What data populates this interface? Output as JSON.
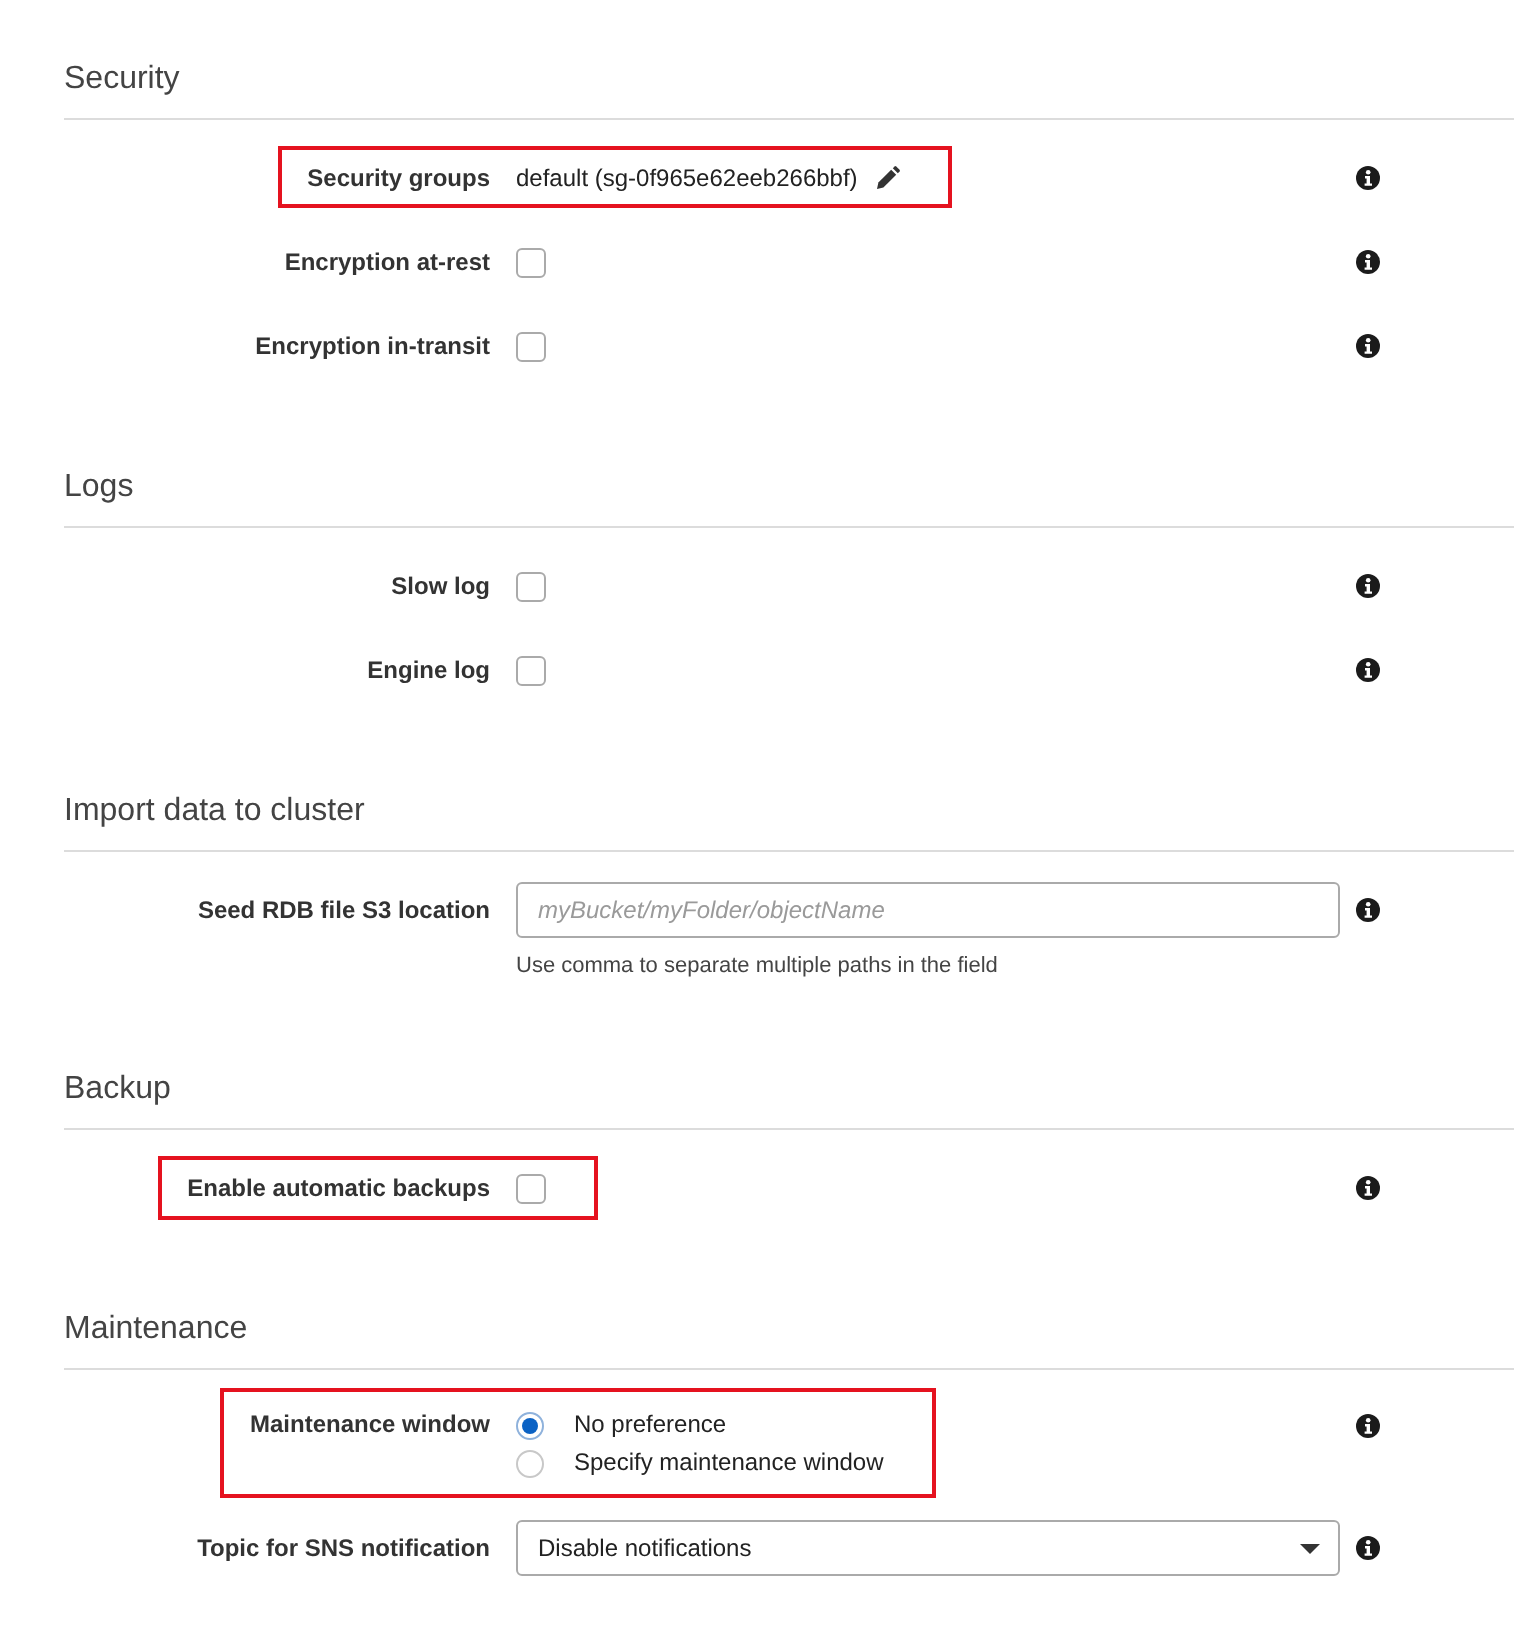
{
  "sections": [
    {
      "title": "Security",
      "rows": [
        {
          "kind": "value",
          "label": "Security groups",
          "value": "default (sg-0f965e62eeb266bbf)",
          "editable": true,
          "highlighted": true
        },
        {
          "kind": "checkbox",
          "label": "Encryption at-rest",
          "checked": false,
          "highlighted": false
        },
        {
          "kind": "checkbox",
          "label": "Encryption in-transit",
          "checked": false,
          "highlighted": false
        }
      ]
    },
    {
      "title": "Logs",
      "rows": [
        {
          "kind": "checkbox",
          "label": "Slow log",
          "checked": false,
          "highlighted": false
        },
        {
          "kind": "checkbox",
          "label": "Engine log",
          "checked": false,
          "highlighted": false
        }
      ]
    },
    {
      "title": "Import data to cluster",
      "rows": [
        {
          "kind": "input",
          "label": "Seed RDB file S3 location",
          "placeholder": "myBucket/myFolder/objectName",
          "hint": "Use comma to separate multiple paths in the field",
          "highlighted": false
        }
      ]
    },
    {
      "title": "Backup",
      "rows": [
        {
          "kind": "checkbox",
          "label": "Enable automatic backups",
          "checked": false,
          "highlighted": true
        }
      ]
    },
    {
      "title": "Maintenance",
      "rows": [
        {
          "kind": "radio",
          "label": "Maintenance window",
          "options": [
            {
              "label": "No preference",
              "selected": true
            },
            {
              "label": "Specify maintenance window",
              "selected": false
            }
          ],
          "highlighted": true
        },
        {
          "kind": "select",
          "label": "Topic for SNS notification",
          "value": "Disable notifications",
          "highlighted": false
        }
      ]
    }
  ]
}
